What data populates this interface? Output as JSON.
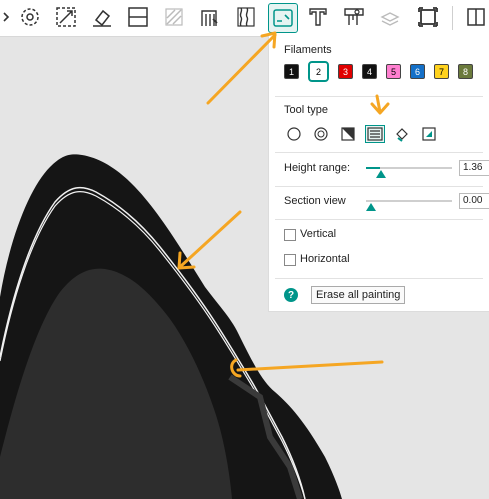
{
  "toolbar": {
    "buttons": [
      {
        "name": "arrow-right-icon"
      },
      {
        "name": "rotate-icon"
      },
      {
        "name": "scale-icon"
      },
      {
        "name": "eraser-icon"
      },
      {
        "name": "cut-plane-icon"
      },
      {
        "name": "support-paint-icon"
      },
      {
        "name": "seam-paint-icon"
      },
      {
        "name": "fuzzy-skin-icon"
      },
      {
        "name": "color-paint-icon"
      },
      {
        "name": "text-emboss-icon"
      },
      {
        "name": "measure-icon"
      },
      {
        "name": "assembly-icon"
      },
      {
        "name": "fit-frame-icon"
      },
      {
        "name": "split-view-icon"
      }
    ]
  },
  "panel": {
    "filaments_title": "Filaments",
    "filaments": [
      {
        "label": "1",
        "color": "#111111",
        "text": "#ffffff"
      },
      {
        "label": "2",
        "color": "#ffffff",
        "text": "#000000"
      },
      {
        "label": "3",
        "color": "#e00000",
        "text": "#ffffff"
      },
      {
        "label": "4",
        "color": "#111111",
        "text": "#ffffff"
      },
      {
        "label": "5",
        "color": "#ff7fd0",
        "text": "#000000"
      },
      {
        "label": "6",
        "color": "#1470c8",
        "text": "#ffffff"
      },
      {
        "label": "7",
        "color": "#ffd21e",
        "text": "#000000"
      },
      {
        "label": "8",
        "color": "#6b7a3c",
        "text": "#ffffff"
      }
    ],
    "tool_type_title": "Tool type",
    "height_range_label": "Height range:",
    "height_range_value": "1.36",
    "section_view_label": "Section view",
    "section_view_value": "0.00",
    "vertical_label": "Vertical",
    "horizontal_label": "Horizontal",
    "help_label": "?",
    "erase_label": "Erase all painting"
  },
  "colors": {
    "accent": "#00958a",
    "annotation": "#f5a623",
    "model": "#1a1a1a"
  }
}
